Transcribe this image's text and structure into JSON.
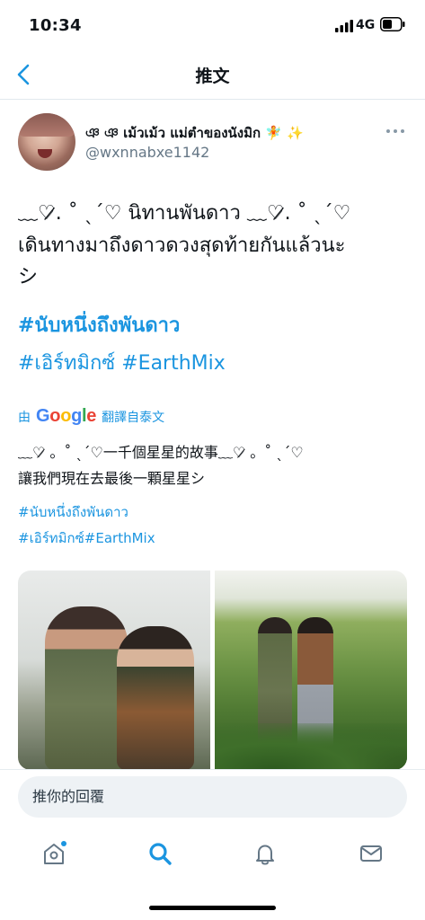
{
  "status_bar": {
    "time": "10:34",
    "network": "4G"
  },
  "nav": {
    "title": "推文",
    "back_icon": "chevron-left-icon"
  },
  "author": {
    "name": "ঞ ঞ เม้วเม้ว แม่ตำของนังมิก 🧚 ✨",
    "handle": "@wxnnabxe1142",
    "more_icon": "ellipsis-icon"
  },
  "tweet": {
    "line_1": "﹏♡̷. ˚ ˎˊ♡ นิทานพันดาว ﹏♡̷. ˚ ˎˊ♡",
    "line_2": "เดินทางมาถึงดาวดวงสุดท้ายกันแล้วนะ",
    "line_3": "シ",
    "hashtag_1": "#นับหนึ่งถึงพันดาว",
    "hashtag_2": "#เอิร์ทมิกซ์ #EarthMix"
  },
  "translation": {
    "by": "由",
    "google": "Google",
    "label": "翻譯自泰文",
    "line_1": "﹏♡̷ 。˚ ˎˊ♡一千個星星的故事﹏♡̷ 。˚ ˎˊ♡",
    "line_2": "讓我們現在去最後一顆星星シ",
    "hashtag_1": "#นับหนึ่งถึงพันดาว",
    "hashtag_2": "#เอิร์ทมิกซ์#EarthMix"
  },
  "reply": {
    "placeholder": "推你的回覆"
  },
  "tabs": {
    "home_icon": "home-icon",
    "search_icon": "search-icon",
    "notifications_icon": "bell-icon",
    "messages_icon": "mail-icon"
  },
  "colors": {
    "accent": "#1b95e0",
    "text": "#0f1419",
    "secondary": "#657786",
    "reply_bg": "#eef2f5"
  }
}
